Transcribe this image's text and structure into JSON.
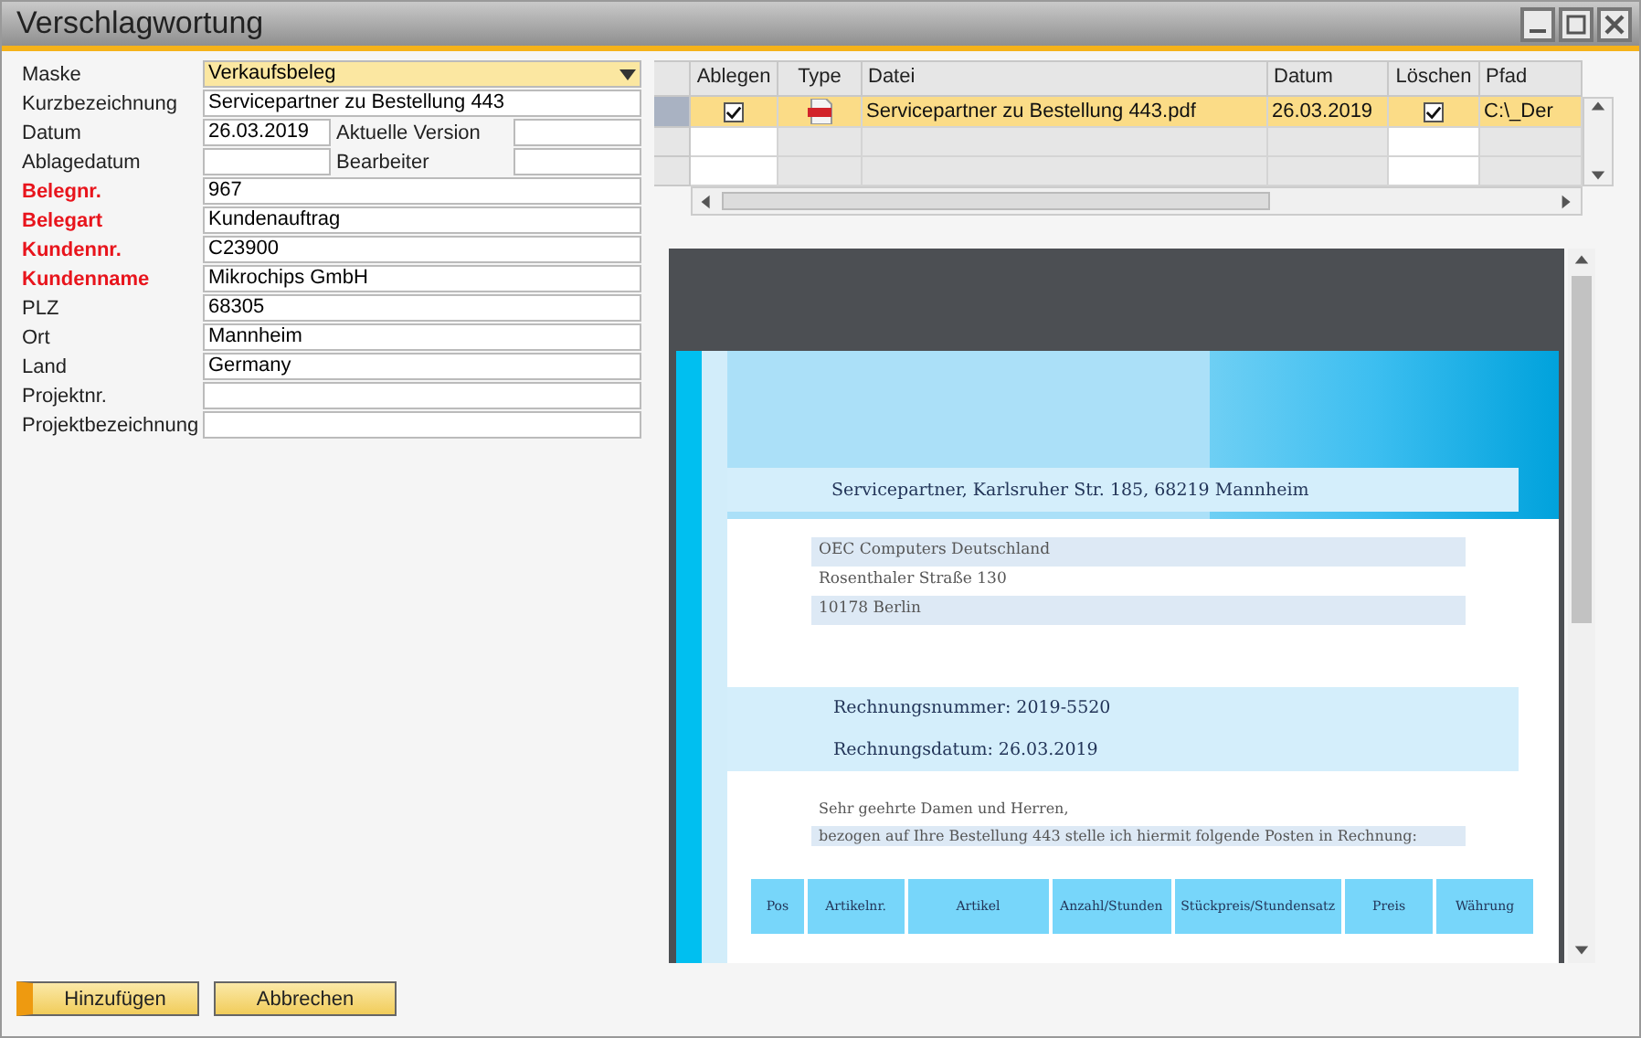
{
  "window": {
    "title": "Verschlagwortung"
  },
  "form": {
    "rows": [
      {
        "label": "Maske",
        "value": "Verkaufsbeleg",
        "kind": "dropdown",
        "required": false
      },
      {
        "label": "Kurzbezeichnung",
        "value": "Servicepartner zu Bestellung 443",
        "kind": "text",
        "required": false
      },
      {
        "label": "Datum",
        "value": "26.03.2019",
        "kind": "split",
        "required": false,
        "side": {
          "label": "Aktuelle Version"
        }
      },
      {
        "label": "Ablagedatum",
        "kind": "split",
        "required": false,
        "side": {
          "label": "Bearbeiter"
        }
      },
      {
        "label": "Belegnr.",
        "value": "967",
        "kind": "text",
        "required": true
      },
      {
        "label": "Belegart",
        "value": "Kundenauftrag",
        "kind": "text",
        "required": true
      },
      {
        "label": "Kundennr.",
        "value": "C23900",
        "kind": "text",
        "required": true
      },
      {
        "label": "Kundenname",
        "value": "Mikrochips GmbH",
        "kind": "text",
        "required": true
      },
      {
        "label": "PLZ",
        "value": "68305",
        "kind": "text",
        "required": false
      },
      {
        "label": "Ort",
        "value": "Mannheim",
        "kind": "text",
        "required": false
      },
      {
        "label": "Land",
        "value": "Germany",
        "kind": "text",
        "required": false
      },
      {
        "label": "Projektnr.",
        "kind": "text",
        "required": false
      },
      {
        "label": "Projektbezeichnung",
        "kind": "text",
        "required": false
      }
    ]
  },
  "files": {
    "columns": [
      "Ablegen",
      "Type",
      "Datei",
      "Datum",
      "Löschen",
      "Pfad"
    ],
    "rows": [
      {
        "selected": true,
        "ablegen": true,
        "datei": "Servicepartner zu Bestellung 443.pdf",
        "datum": "26.03.2019",
        "loeschen": true,
        "pfad": "C:\\_Der"
      }
    ]
  },
  "preview": {
    "sender": "Servicepartner,  Karlsruher Str. 185, 68219 Mannheim",
    "recipient": [
      "OEC Computers Deutschland",
      "Rosenthaler Straße 130",
      "10178 Berlin"
    ],
    "invoice_lines": [
      "Rechnungsnummer: 2019-5520",
      "Rechnungsdatum: 26.03.2019"
    ],
    "greeting": "Sehr geehrte Damen und Herren,",
    "intro": "bezogen auf Ihre Bestellung 443 stelle ich hiermit folgende Posten in Rechnung:",
    "table_columns": [
      "Pos",
      "Artikelnr.",
      "Artikel",
      "Anzahl/Stunden",
      "Stückpreis/Stundensatz",
      "Preis",
      "Währung"
    ]
  },
  "buttons": [
    {
      "label": "Hinzufügen",
      "default": true
    },
    {
      "label": "Abbrechen",
      "default": false
    }
  ]
}
